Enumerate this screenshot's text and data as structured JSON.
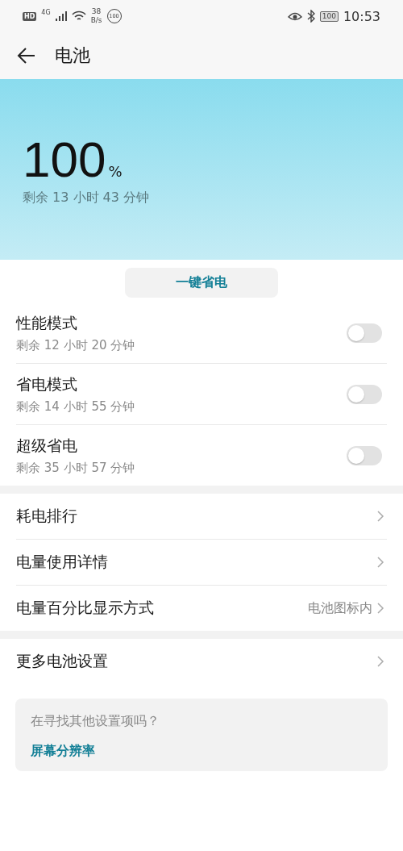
{
  "status_bar": {
    "hd": "HD",
    "network": "4G",
    "speed": "38",
    "speed_unit": "B/s",
    "notification_badge": "100",
    "battery": "100",
    "time": "10:53"
  },
  "header": {
    "title": "电池"
  },
  "battery": {
    "percent": "100",
    "unit": "%",
    "remaining": "剩余 13 小时 43 分钟"
  },
  "one_tap_button": "一键省电",
  "modes": [
    {
      "title": "性能模式",
      "subtitle": "剩余 12 小时 20 分钟",
      "on": false
    },
    {
      "title": "省电模式",
      "subtitle": "剩余 14 小时 55 分钟",
      "on": false
    },
    {
      "title": "超级省电",
      "subtitle": "剩余 35 小时 57 分钟",
      "on": false
    }
  ],
  "sections": [
    {
      "items": [
        {
          "label": "耗电排行"
        },
        {
          "label": "电量使用详情"
        },
        {
          "label": "电量百分比显示方式",
          "value": "电池图标内"
        }
      ]
    },
    {
      "items": [
        {
          "label": "更多电池设置"
        }
      ]
    }
  ],
  "suggestion": {
    "question": "在寻找其他设置项吗？",
    "link": "屏幕分辨率"
  }
}
